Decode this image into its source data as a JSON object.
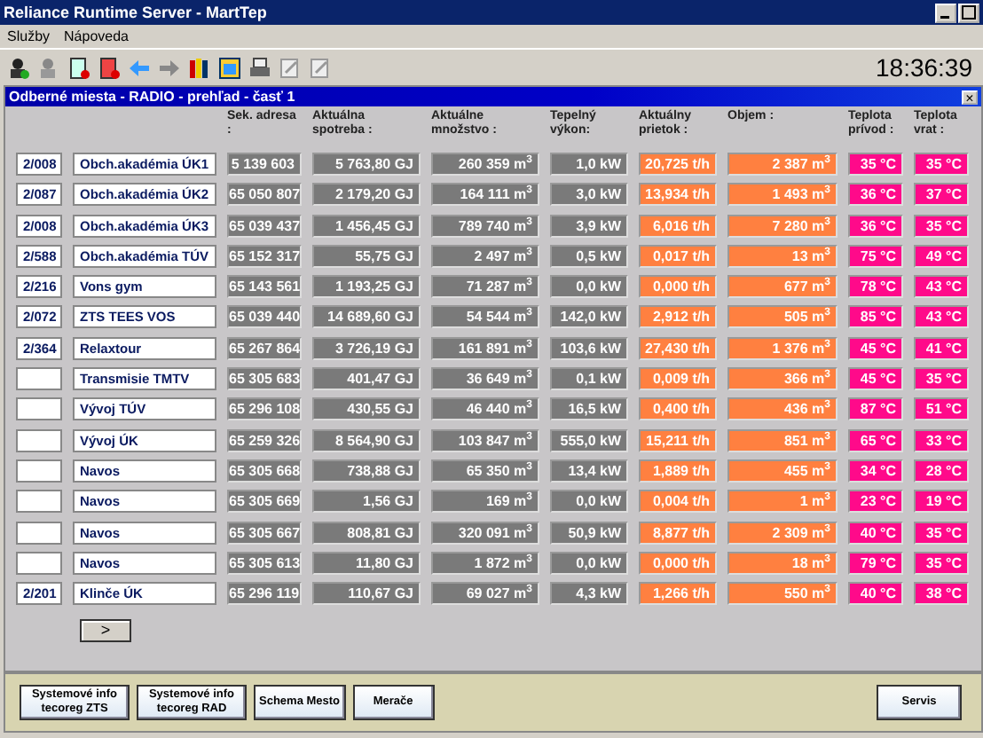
{
  "window": {
    "title": "Reliance Runtime Server - MartTep"
  },
  "menu": [
    "Služby",
    "Nápoveda"
  ],
  "clock": "18:36:39",
  "subwindow": {
    "title": "Odberné miesta - RADIO - prehľad - časť 1",
    "close": "×"
  },
  "columns": [
    "Sek. adresa :",
    "Aktuálna spotreba :",
    "Aktuálne množstvo :",
    "Tepelný výkon:",
    "Aktuálny prietok :",
    "Objem :",
    "Teplota prívod :",
    "Teplota vrat :"
  ],
  "rows": [
    {
      "code": "2/008",
      "name": "Obch.akadémia ÚK1",
      "address": "5 139 603",
      "consumption": "5 763,80 GJ",
      "amount": "260 359 m$^{3}$",
      "power": "1,0 kW",
      "flow": "20,725 t/h",
      "volume": "2 387 m$^{3}$",
      "temp_supply": "35 °C",
      "temp_return": "35 °C"
    },
    {
      "code": "2/087",
      "name": "Obch.akadémia ÚK2",
      "address": "65 050 807",
      "consumption": "2 179,20 GJ",
      "amount": "164 111 m$^{3}$",
      "power": "3,0 kW",
      "flow": "13,934 t/h",
      "volume": "1 493 m$^{3}$",
      "temp_supply": "36 °C",
      "temp_return": "37 °C"
    },
    {
      "code": "2/008",
      "name": "Obch.akadémia ÚK3",
      "address": "65 039 437",
      "consumption": "1 456,45 GJ",
      "amount": "789 740 m$^{3}$",
      "power": "3,9 kW",
      "flow": "6,016 t/h",
      "volume": "7 280 m$^{3}$",
      "temp_supply": "36 °C",
      "temp_return": "35 °C"
    },
    {
      "code": "2/588",
      "name": "Obch.akadémia TÚV",
      "address": "65 152 317",
      "consumption": "55,75 GJ",
      "amount": "2 497 m$^{3}$",
      "power": "0,5 kW",
      "flow": "0,017 t/h",
      "volume": "13 m$^{3}$",
      "temp_supply": "75 °C",
      "temp_return": "49 °C"
    },
    {
      "code": "2/216",
      "name": "Vons gym",
      "address": "65 143 561",
      "consumption": "1 193,25 GJ",
      "amount": "71 287 m$^{3}$",
      "power": "0,0 kW",
      "flow": "0,000 t/h",
      "volume": "677 m$^{3}$",
      "temp_supply": "78 °C",
      "temp_return": "43 °C"
    },
    {
      "code": "2/072",
      "name": "ZTS TEES VOS",
      "address": "65 039 440",
      "consumption": "14 689,60 GJ",
      "amount": "54 544 m$^{3}$",
      "power": "142,0 kW",
      "flow": "2,912 t/h",
      "volume": "505 m$^{3}$",
      "temp_supply": "85 °C",
      "temp_return": "43 °C"
    },
    {
      "code": "2/364",
      "name": "Relaxtour",
      "address": "65 267 864",
      "consumption": "3 726,19 GJ",
      "amount": "161 891 m$^{3}$",
      "power": "103,6 kW",
      "flow": "27,430 t/h",
      "volume": "1 376 m$^{3}$",
      "temp_supply": "45 °C",
      "temp_return": "41 °C"
    },
    {
      "name": "Transmisie TMTV",
      "address": "65 305 683",
      "consumption": "401,47 GJ",
      "amount": "36 649 m$^{3}$",
      "power": "0,1 kW",
      "flow": "0,009 t/h",
      "volume": "366 m$^{3}$",
      "temp_supply": "45 °C",
      "temp_return": "35 °C"
    },
    {
      "name": "Vývoj TÚV",
      "address": "65 296 108",
      "consumption": "430,55 GJ",
      "amount": "46 440 m$^{3}$",
      "power": "16,5 kW",
      "flow": "0,400 t/h",
      "volume": "436 m$^{3}$",
      "temp_supply": "87 °C",
      "temp_return": "51 °C"
    },
    {
      "name": "Vývoj ÚK",
      "address": "65 259 326",
      "consumption": "8 564,90 GJ",
      "amount": "103 847 m$^{3}$",
      "power": "555,0 kW",
      "flow": "15,211 t/h",
      "volume": "851 m$^{3}$",
      "temp_supply": "65 °C",
      "temp_return": "33 °C"
    },
    {
      "name": "Navos",
      "address": "65 305 668",
      "consumption": "738,88 GJ",
      "amount": "65 350 m$^{3}$",
      "power": "13,4 kW",
      "flow": "1,889 t/h",
      "volume": "455 m$^{3}$",
      "temp_supply": "34 °C",
      "temp_return": "28 °C"
    },
    {
      "name": "Navos",
      "address": "65 305 669",
      "consumption": "1,56 GJ",
      "amount": "169 m$^{3}$",
      "power": "0,0 kW",
      "flow": "0,004 t/h",
      "volume": "1 m$^{3}$",
      "temp_supply": "23 °C",
      "temp_return": "19 °C"
    },
    {
      "name": "Navos",
      "address": "65 305 667",
      "consumption": "808,81 GJ",
      "amount": "320 091 m$^{3}$",
      "power": "50,9 kW",
      "flow": "8,877 t/h",
      "volume": "2 309 m$^{3}$",
      "temp_supply": "40 °C",
      "temp_return": "35 °C"
    },
    {
      "name": "Navos",
      "address": "65 305 613",
      "consumption": "11,80 GJ",
      "amount": "1 872 m$^{3}$",
      "power": "0,0 kW",
      "flow": "0,000 t/h",
      "volume": "18 m$^{3}$",
      "temp_supply": "79 °C",
      "temp_return": "35 °C"
    },
    {
      "code": "2/201",
      "name": "Klinče ÚK",
      "address": "65 296 119",
      "consumption": "110,67 GJ",
      "amount": "69 027 m$^{3}$",
      "power": "4,3 kW",
      "flow": "1,266 t/h",
      "volume": "550 m$^{3}$",
      "temp_supply": "40 °C",
      "temp_return": "38 °C"
    }
  ],
  "next_button": ">",
  "bottom_buttons": [
    "Systemové info tecoreg ZTS",
    "Systemové info tecoreg RAD",
    "Schema Mesto",
    "Merače"
  ],
  "service_button": "Servis"
}
